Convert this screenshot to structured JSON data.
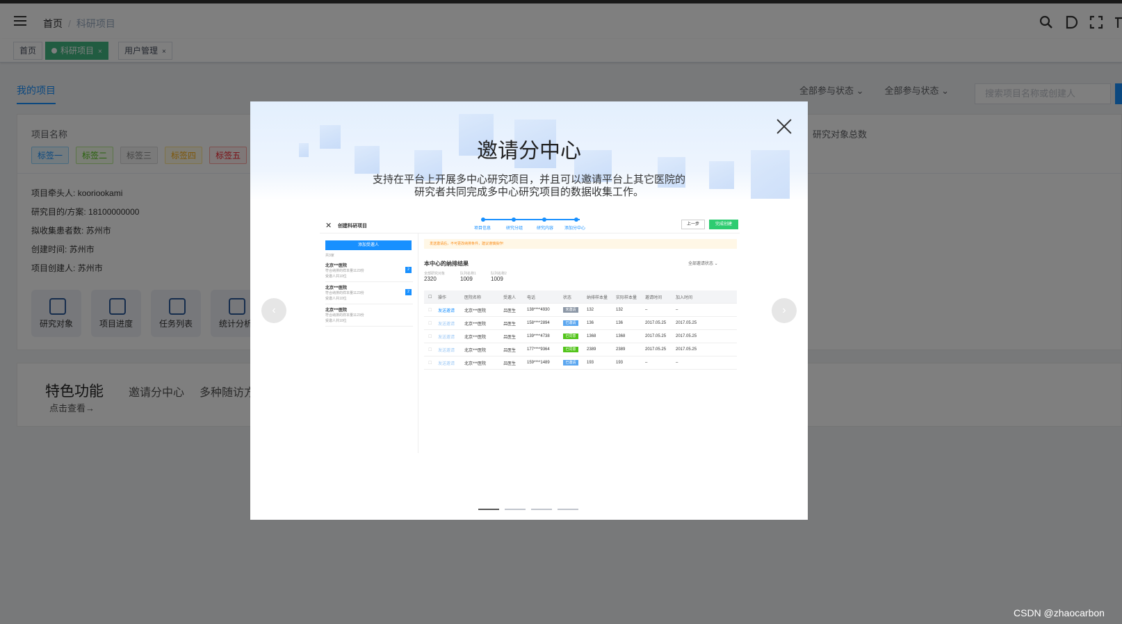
{
  "topbar": {
    "breadcrumb": [
      "首页",
      "科研项目"
    ],
    "separator": "/"
  },
  "tags": [
    {
      "label": "首页",
      "active": false,
      "closable": false
    },
    {
      "label": "科研项目",
      "active": true,
      "closable": true
    },
    {
      "label": "用户管理",
      "active": false,
      "closable": true
    }
  ],
  "tag_close": "×",
  "page": {
    "tab": "我的项目",
    "filter1": "全部参与状态",
    "filter2": "全部参与状态",
    "search_placeholder": "搜索项目名称或创建人",
    "project_name_label": "项目名称",
    "research_total_label": "研究对象总数",
    "labels": [
      {
        "text": "标签一",
        "color": "#1890ff"
      },
      {
        "text": "标签二",
        "color": "#52c41a"
      },
      {
        "text": "标签三",
        "color": "#888888"
      },
      {
        "text": "标签四",
        "color": "#faad14"
      },
      {
        "text": "标签五",
        "color": "#f5222d"
      }
    ],
    "info": [
      {
        "label": "项目牵头人:",
        "value": "kooriookami"
      },
      {
        "label": "研究目的/方案:",
        "value": "18100000000"
      },
      {
        "label": "拟收集患者数:",
        "value": "苏州市"
      },
      {
        "label": "创建时间:",
        "value": "苏州市"
      },
      {
        "label": "项目创建人:",
        "value": "苏州市"
      }
    ],
    "quick": [
      "研究对象",
      "项目进度",
      "任务列表",
      "统计分析"
    ],
    "features_title": "特色功能",
    "features_more": "点击查看→",
    "feature_items": [
      "邀请分中心",
      "多种随访方"
    ]
  },
  "dialog": {
    "title": "邀请分中心",
    "description_line1": "支持在平台上开展多中心研究项目，并且可以邀请平台上其它医院的",
    "description_line2": "研究者共同完成多中心研究项目的数据收集工作。",
    "prev_arrow": "‹",
    "next_arrow": "›",
    "slide_count": 4,
    "active_slide": 0
  },
  "screenshot": {
    "close": "✕",
    "title": "创建科研项目",
    "steps": [
      "项目信息",
      "研究分组",
      "研究内容",
      "添加分中心"
    ],
    "prev": "上一步",
    "done": "完成创建",
    "add_invitee": "添加受邀人",
    "total": "共3家",
    "hospitals": [
      {
        "name": "北京***医院",
        "line1": "符合纳排的样本量1123份",
        "line2": "受邀人共10位",
        "badge": "2"
      },
      {
        "name": "北京***医院",
        "line1": "符合纳排的样本量1123份",
        "line2": "受邀人共10位",
        "badge": "2"
      },
      {
        "name": "北京***医院",
        "line1": "符合纳排的样本量1123份",
        "line2": "受邀人共10位",
        "badge": ""
      }
    ],
    "warning": "发送邀请后，不可更改纳排条件，建议谨慎操作!",
    "section": "本中心的纳排结果",
    "section_filter": "全部邀请状态 ⌄",
    "stats": [
      {
        "label": "全部研究对象",
        "value": "2320"
      },
      {
        "label": "队列名称1",
        "value": "1009"
      },
      {
        "label": "队列名称2",
        "value": "1009"
      }
    ],
    "columns": [
      "操作",
      "医院名称",
      "受邀人",
      "电话",
      "状态",
      "纳排样本量",
      "实际样本量",
      "邀请时间",
      "加入时间"
    ],
    "rows": [
      {
        "action": "发送邀请",
        "hospital": "北京***医院",
        "invitee": "吕医生",
        "phone": "138****4930",
        "status": "未邀请",
        "status_color": "#8c97a6",
        "n1": "132",
        "n2": "132",
        "invite": "–",
        "join": "–"
      },
      {
        "action": "发送邀请",
        "hospital": "北京***医院",
        "invitee": "吕医生",
        "phone": "158****2894",
        "status": "已邀请",
        "status_color": "#5aa6f0",
        "n1": "136",
        "n2": "136",
        "invite": "2017.05.25",
        "join": "2017.05.25"
      },
      {
        "action": "发送邀请",
        "hospital": "北京***医院",
        "invitee": "吕医生",
        "phone": "139****4738",
        "status": "已同意",
        "status_color": "#52c41a",
        "n1": "1368",
        "n2": "1368",
        "invite": "2017.05.25",
        "join": "2017.05.25"
      },
      {
        "action": "发送邀请",
        "hospital": "北京***医院",
        "invitee": "吕医生",
        "phone": "177****9364",
        "status": "已同意",
        "status_color": "#52c41a",
        "n1": "2389",
        "n2": "2389",
        "invite": "2017.05.25",
        "join": "2017.05.25"
      },
      {
        "action": "发送邀请",
        "hospital": "北京***医院",
        "invitee": "吕医生",
        "phone": "159****1489",
        "status": "已邀请",
        "status_color": "#5aa6f0",
        "n1": "193",
        "n2": "193",
        "invite": "–",
        "join": "–"
      }
    ]
  },
  "watermark": "CSDN @zhaocarbon"
}
